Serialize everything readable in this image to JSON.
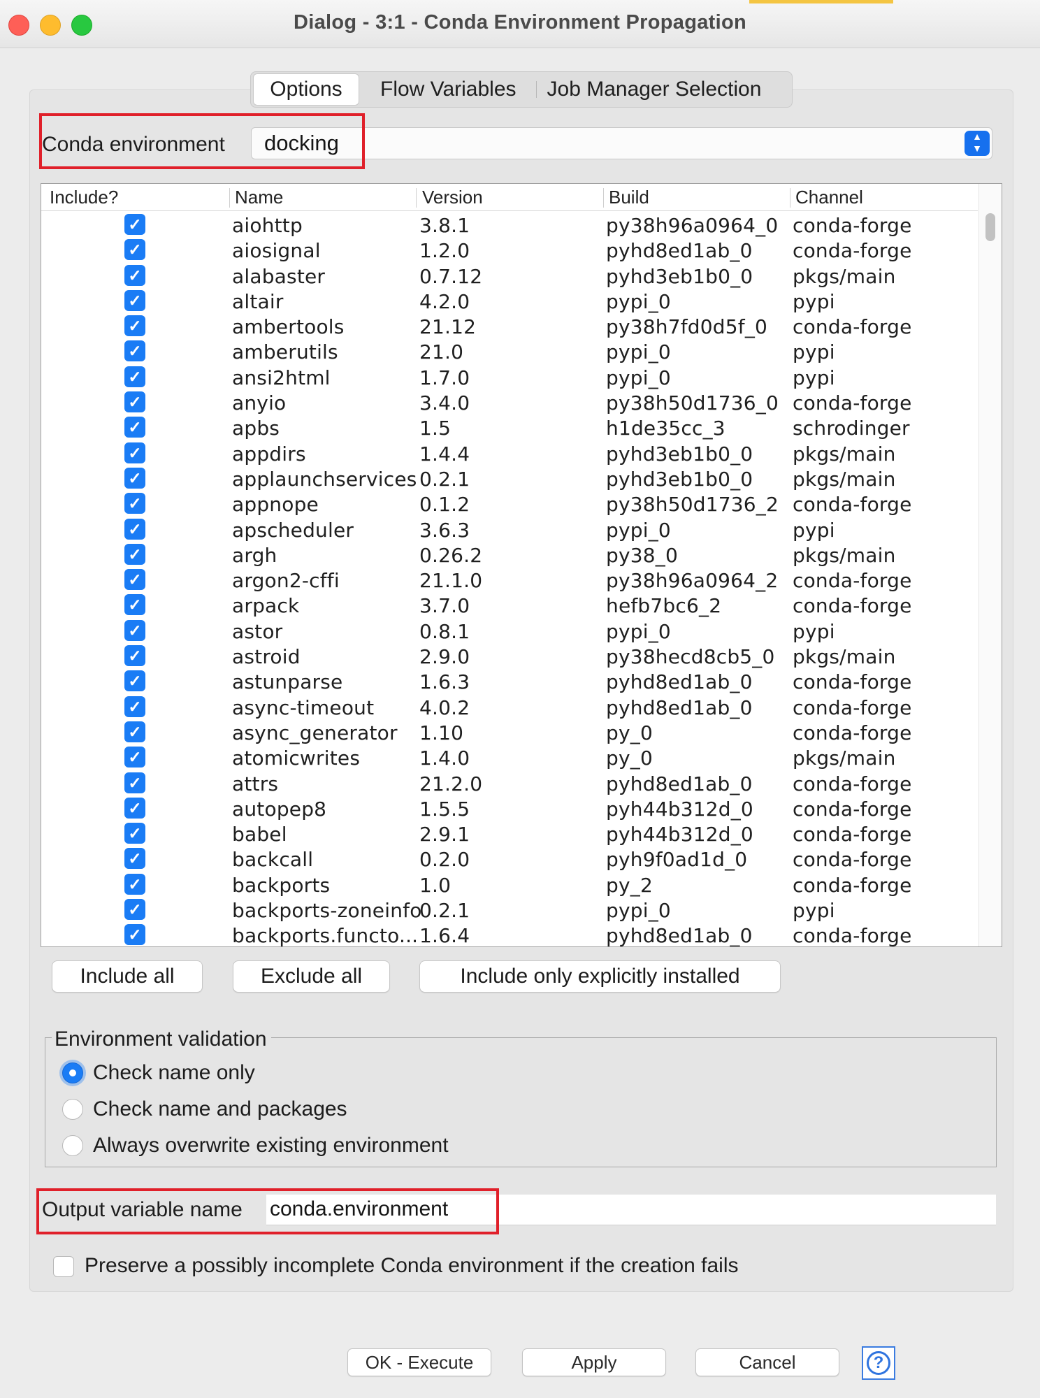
{
  "window": {
    "title": "Dialog - 3:1 - Conda Environment Propagation"
  },
  "tabs": [
    {
      "label": "Options"
    },
    {
      "label": "Flow Variables"
    },
    {
      "label": "Job Manager Selection"
    }
  ],
  "conda": {
    "label": "Conda environment",
    "value": "docking"
  },
  "table": {
    "headers": {
      "include": "Include?",
      "name": "Name",
      "version": "Version",
      "build": "Build",
      "channel": "Channel"
    },
    "rows": [
      {
        "include": true,
        "name": "aiohttp",
        "version": "3.8.1",
        "build": "py38h96a0964_0",
        "channel": "conda-forge"
      },
      {
        "include": true,
        "name": "aiosignal",
        "version": "1.2.0",
        "build": "pyhd8ed1ab_0",
        "channel": "conda-forge"
      },
      {
        "include": true,
        "name": "alabaster",
        "version": "0.7.12",
        "build": "pyhd3eb1b0_0",
        "channel": "pkgs/main"
      },
      {
        "include": true,
        "name": "altair",
        "version": "4.2.0",
        "build": "pypi_0",
        "channel": "pypi"
      },
      {
        "include": true,
        "name": "ambertools",
        "version": "21.12",
        "build": "py38h7fd0d5f_0",
        "channel": "conda-forge"
      },
      {
        "include": true,
        "name": "amberutils",
        "version": "21.0",
        "build": "pypi_0",
        "channel": "pypi"
      },
      {
        "include": true,
        "name": "ansi2html",
        "version": "1.7.0",
        "build": "pypi_0",
        "channel": "pypi"
      },
      {
        "include": true,
        "name": "anyio",
        "version": "3.4.0",
        "build": "py38h50d1736_0",
        "channel": "conda-forge"
      },
      {
        "include": true,
        "name": "apbs",
        "version": "1.5",
        "build": "h1de35cc_3",
        "channel": "schrodinger"
      },
      {
        "include": true,
        "name": "appdirs",
        "version": "1.4.4",
        "build": "pyhd3eb1b0_0",
        "channel": "pkgs/main"
      },
      {
        "include": true,
        "name": "applaunchservices",
        "version": "0.2.1",
        "build": "pyhd3eb1b0_0",
        "channel": "pkgs/main"
      },
      {
        "include": true,
        "name": "appnope",
        "version": "0.1.2",
        "build": "py38h50d1736_2",
        "channel": "conda-forge"
      },
      {
        "include": true,
        "name": "apscheduler",
        "version": "3.6.3",
        "build": "pypi_0",
        "channel": "pypi"
      },
      {
        "include": true,
        "name": "argh",
        "version": "0.26.2",
        "build": "py38_0",
        "channel": "pkgs/main"
      },
      {
        "include": true,
        "name": "argon2-cffi",
        "version": "21.1.0",
        "build": "py38h96a0964_2",
        "channel": "conda-forge"
      },
      {
        "include": true,
        "name": "arpack",
        "version": "3.7.0",
        "build": "hefb7bc6_2",
        "channel": "conda-forge"
      },
      {
        "include": true,
        "name": "astor",
        "version": "0.8.1",
        "build": "pypi_0",
        "channel": "pypi"
      },
      {
        "include": true,
        "name": "astroid",
        "version": "2.9.0",
        "build": "py38hecd8cb5_0",
        "channel": "pkgs/main"
      },
      {
        "include": true,
        "name": "astunparse",
        "version": "1.6.3",
        "build": "pyhd8ed1ab_0",
        "channel": "conda-forge"
      },
      {
        "include": true,
        "name": "async-timeout",
        "version": "4.0.2",
        "build": "pyhd8ed1ab_0",
        "channel": "conda-forge"
      },
      {
        "include": true,
        "name": "async_generator",
        "version": "1.10",
        "build": "py_0",
        "channel": "conda-forge"
      },
      {
        "include": true,
        "name": "atomicwrites",
        "version": "1.4.0",
        "build": "py_0",
        "channel": "pkgs/main"
      },
      {
        "include": true,
        "name": "attrs",
        "version": "21.2.0",
        "build": "pyhd8ed1ab_0",
        "channel": "conda-forge"
      },
      {
        "include": true,
        "name": "autopep8",
        "version": "1.5.5",
        "build": "pyh44b312d_0",
        "channel": "conda-forge"
      },
      {
        "include": true,
        "name": "babel",
        "version": "2.9.1",
        "build": "pyh44b312d_0",
        "channel": "conda-forge"
      },
      {
        "include": true,
        "name": "backcall",
        "version": "0.2.0",
        "build": "pyh9f0ad1d_0",
        "channel": "conda-forge"
      },
      {
        "include": true,
        "name": "backports",
        "version": "1.0",
        "build": "py_2",
        "channel": "conda-forge"
      },
      {
        "include": true,
        "name": "backports-zoneinfo",
        "version": "0.2.1",
        "build": "pypi_0",
        "channel": "pypi"
      },
      {
        "include": true,
        "name": "backports.functo...",
        "version": "1.6.4",
        "build": "pyhd8ed1ab_0",
        "channel": "conda-forge"
      }
    ]
  },
  "buttons": {
    "include_all": "Include all",
    "exclude_all": "Exclude all",
    "include_explicit": "Include only explicitly installed"
  },
  "validation": {
    "legend": "Environment validation",
    "selected": "Check name only",
    "options": [
      "Check name only",
      "Check name and packages",
      "Always overwrite existing environment"
    ]
  },
  "output": {
    "label": "Output variable name",
    "value": "conda.environment"
  },
  "preserve": {
    "label": "Preserve a possibly incomplete Conda environment if the creation fails",
    "checked": false
  },
  "footer": {
    "ok": "OK - Execute",
    "apply": "Apply",
    "cancel": "Cancel",
    "help": "?"
  },
  "colors": {
    "accent": "#1a7cf5",
    "highlight_box": "#e0202a"
  }
}
